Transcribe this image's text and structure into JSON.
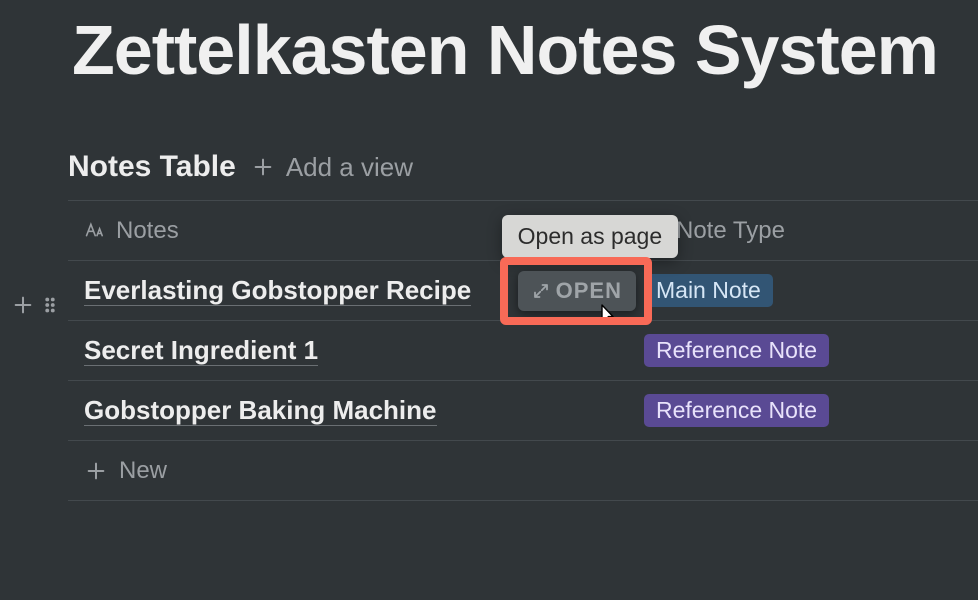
{
  "page": {
    "title": "Zettelkasten Notes System"
  },
  "table": {
    "title": "Notes Table",
    "add_view_label": "Add a view",
    "columns": {
      "notes": "Notes",
      "type": "Note Type"
    },
    "rows": [
      {
        "title": "Everlasting Gobstopper Recipe",
        "type_label": "Main Note",
        "type_kind": "main"
      },
      {
        "title": "Secret Ingredient 1",
        "type_label": "Reference Note",
        "type_kind": "ref"
      },
      {
        "title": "Gobstopper Baking Machine",
        "type_label": "Reference Note",
        "type_kind": "ref"
      }
    ],
    "new_label": "New"
  },
  "hover": {
    "open_button_label": "OPEN",
    "tooltip": "Open as page"
  }
}
